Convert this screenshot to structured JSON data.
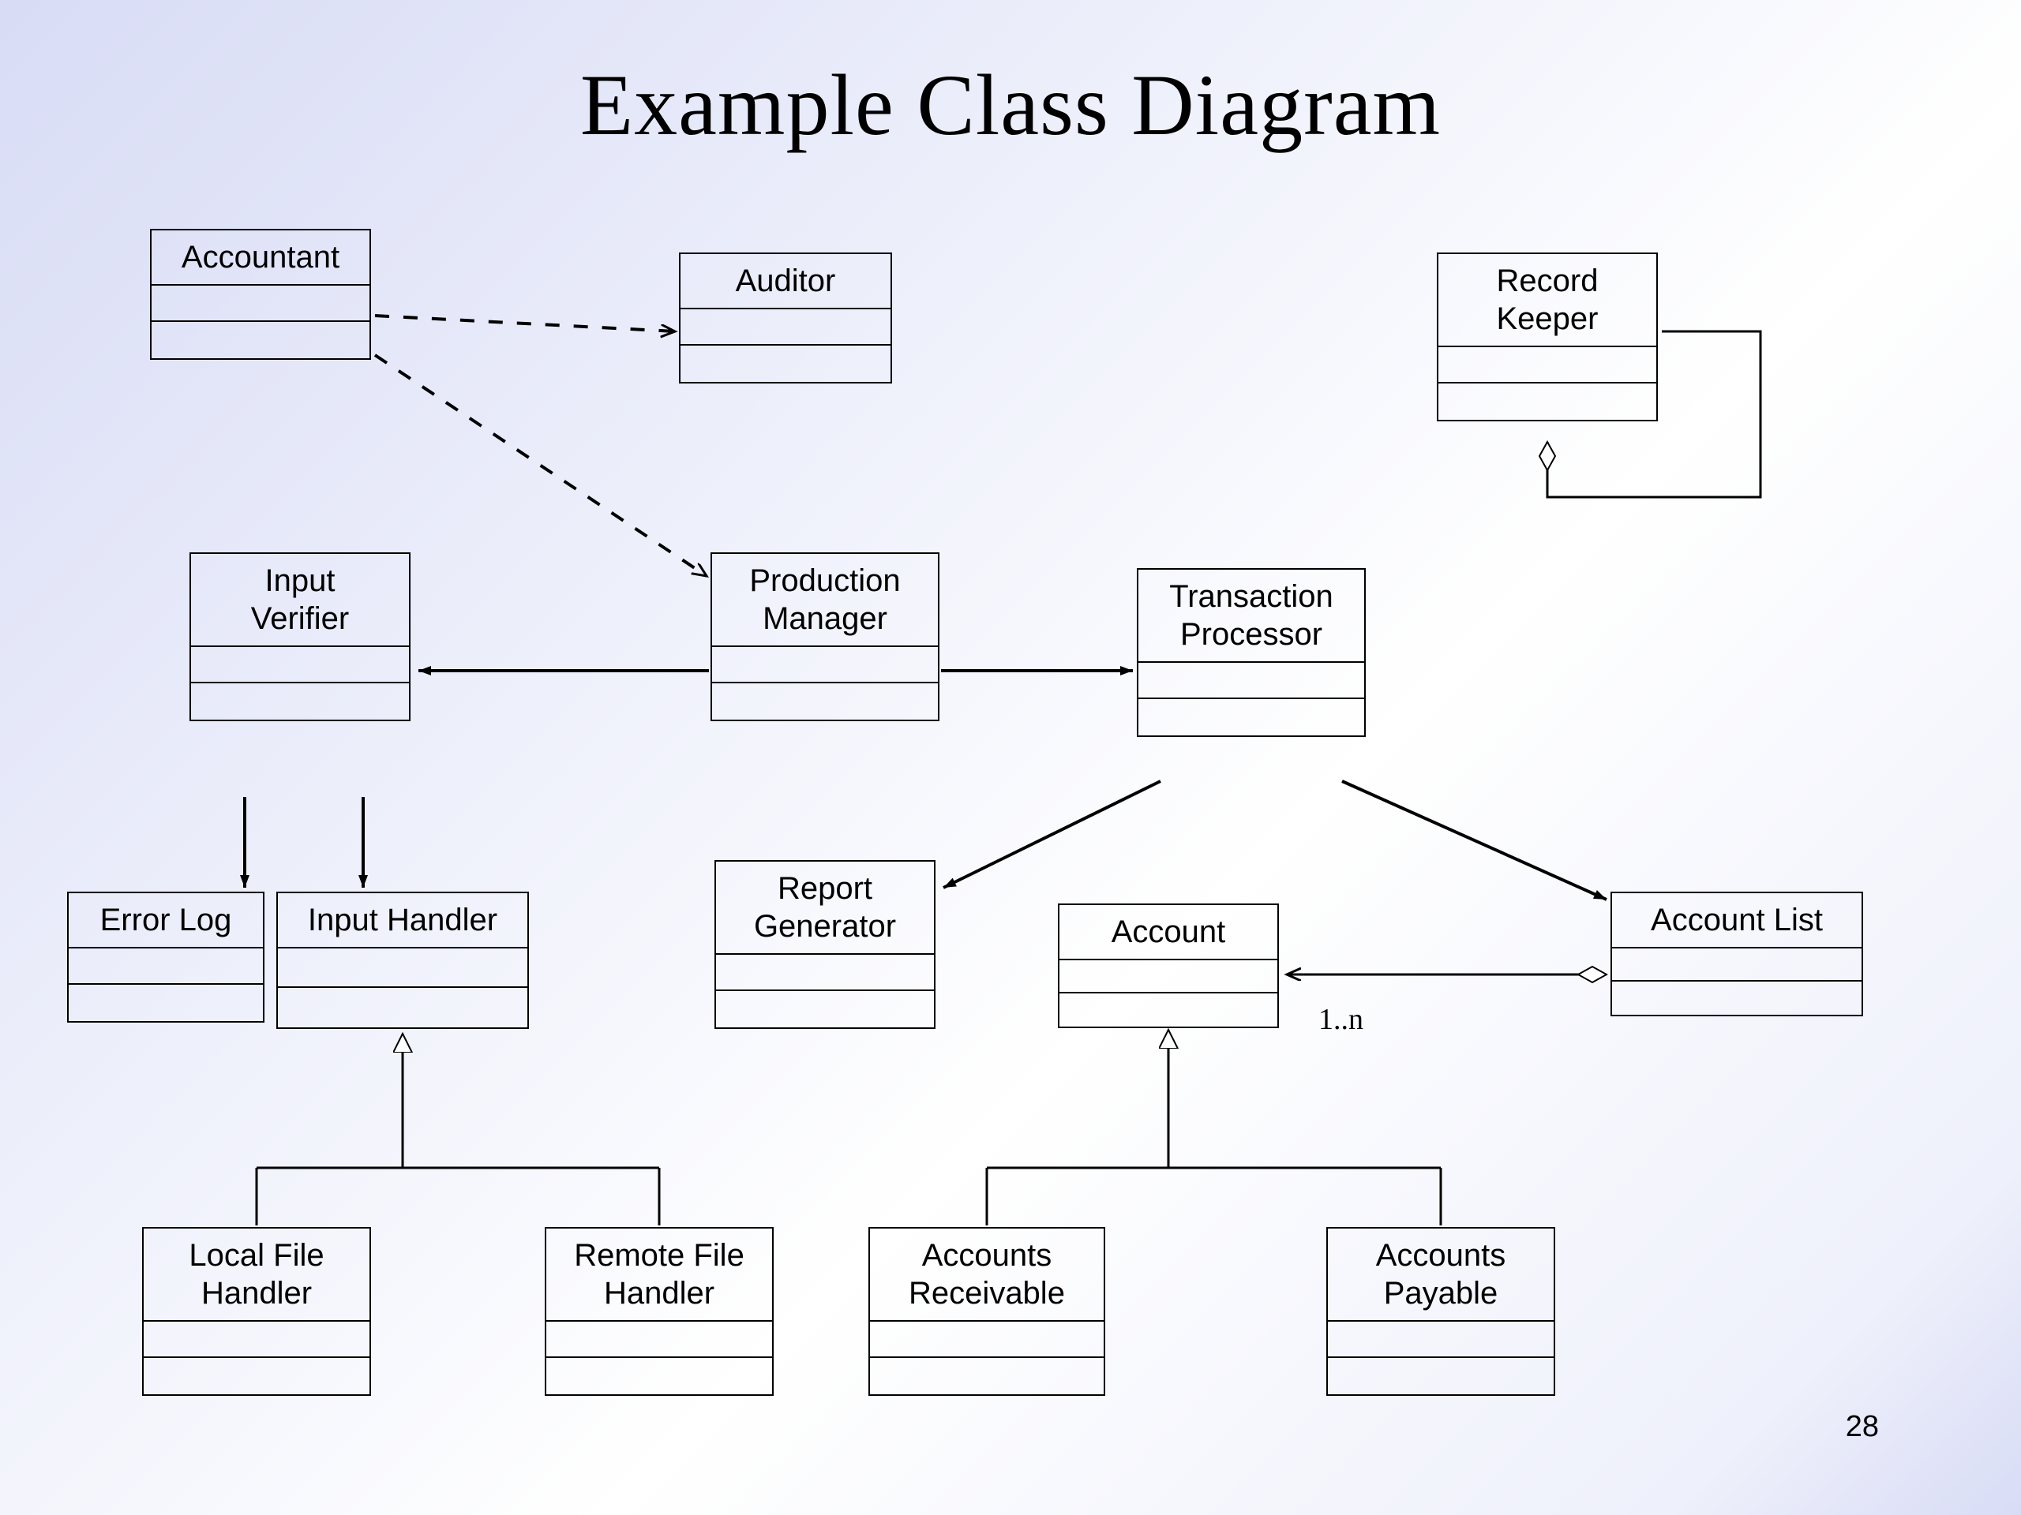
{
  "title": "Example Class Diagram",
  "page_number": "28",
  "classes": {
    "accountant": "Accountant",
    "auditor": "Auditor",
    "record_keeper": "Record\nKeeper",
    "input_verifier": "Input\nVerifier",
    "production_manager": "Production\nManager",
    "transaction_processor": "Transaction\nProcessor",
    "error_log": "Error Log",
    "input_handler": "Input Handler",
    "report_generator": "Report\nGenerator",
    "account": "Account",
    "account_list": "Account List",
    "local_file_handler": "Local File\nHandler",
    "remote_file_handler": "Remote File\nHandler",
    "accounts_receivable": "Accounts\nReceivable",
    "accounts_payable": "Accounts\nPayable"
  },
  "multiplicities": {
    "account_list_to_account": "1..n"
  },
  "relationships": [
    {
      "from": "Accountant",
      "to": "Auditor",
      "type": "dependency"
    },
    {
      "from": "Accountant",
      "to": "Production Manager",
      "type": "dependency"
    },
    {
      "from": "Production Manager",
      "to": "Input Verifier",
      "type": "association_nav"
    },
    {
      "from": "Production Manager",
      "to": "Transaction Processor",
      "type": "association_nav"
    },
    {
      "from": "Input Verifier",
      "to": "Error Log",
      "type": "association_nav"
    },
    {
      "from": "Input Verifier",
      "to": "Input Handler",
      "type": "association_nav"
    },
    {
      "from": "Transaction Processor",
      "to": "Report Generator",
      "type": "association_nav"
    },
    {
      "from": "Transaction Processor",
      "to": "Account List",
      "type": "association_nav"
    },
    {
      "from": "Account List",
      "to": "Account",
      "type": "aggregation",
      "multiplicity": "1..n"
    },
    {
      "from": "Record Keeper",
      "to": "Record Keeper",
      "type": "self_aggregation"
    },
    {
      "from": "Local File Handler",
      "to": "Input Handler",
      "type": "generalization"
    },
    {
      "from": "Remote File Handler",
      "to": "Input Handler",
      "type": "generalization"
    },
    {
      "from": "Accounts Receivable",
      "to": "Account",
      "type": "generalization"
    },
    {
      "from": "Accounts Payable",
      "to": "Account",
      "type": "generalization"
    }
  ]
}
